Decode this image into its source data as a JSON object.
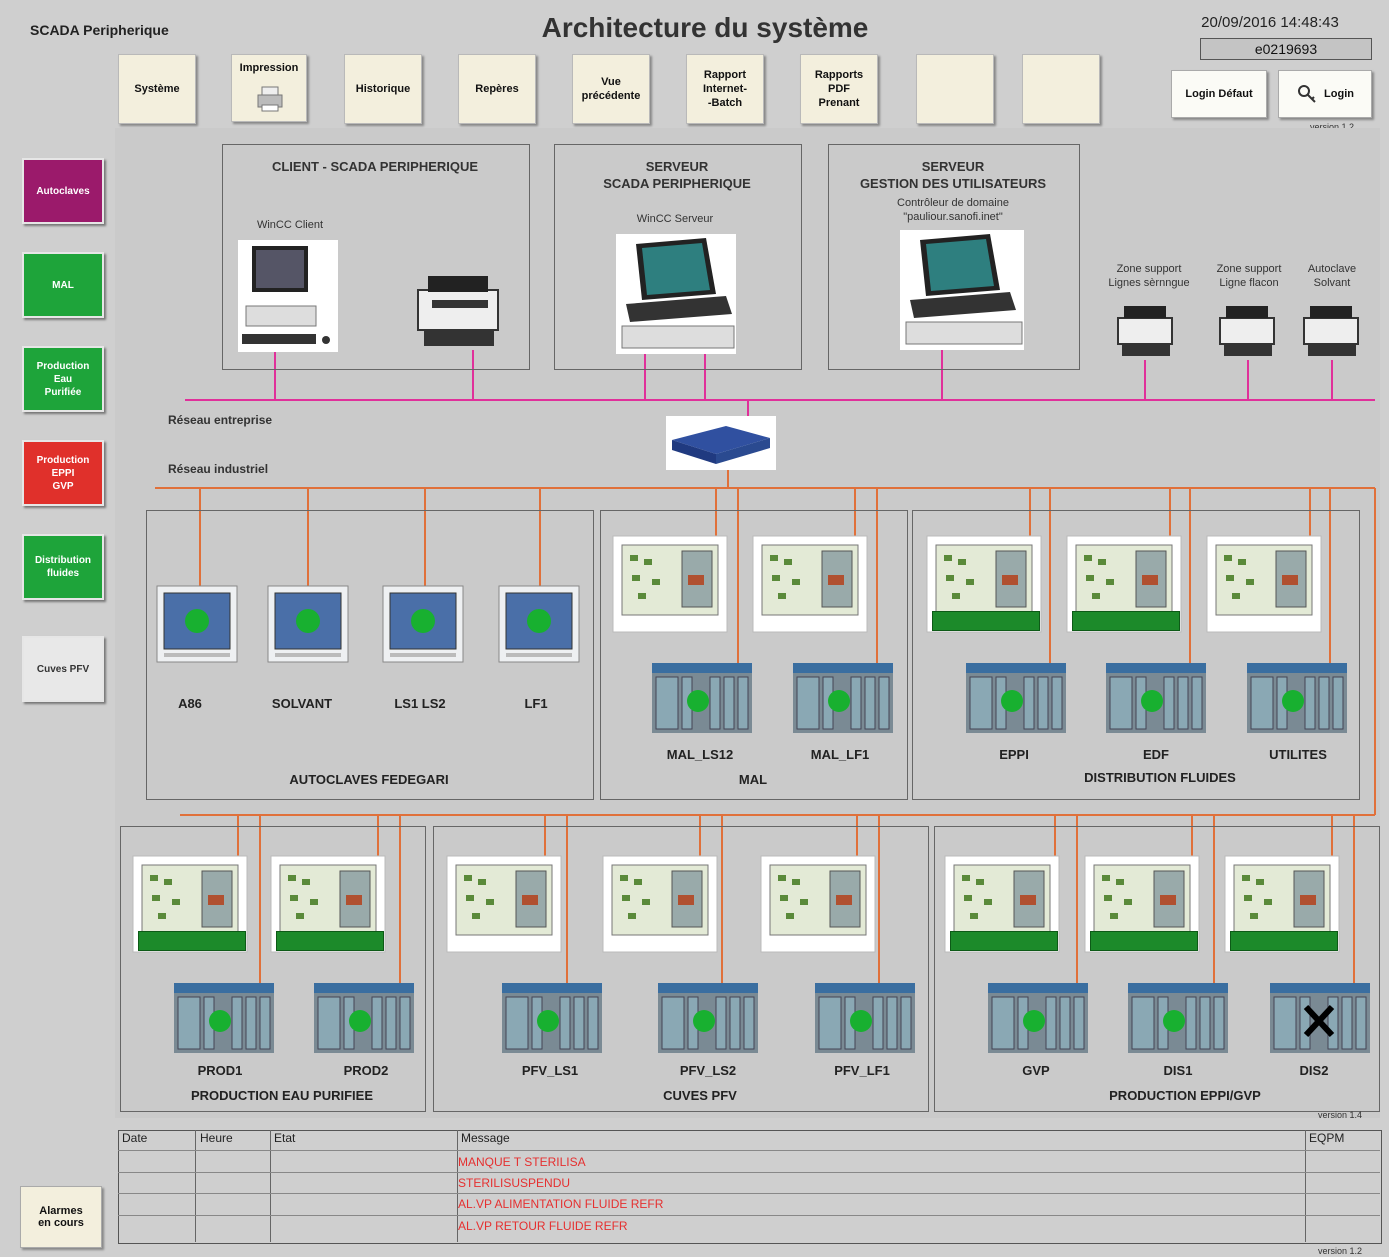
{
  "header": {
    "app_name": "SCADA Peripherique",
    "title": "Architecture du système",
    "datetime": "20/09/2016 14:48:43",
    "user": "e0219693",
    "version_top": "version 1.2"
  },
  "toolbar": {
    "buttons": [
      "Système",
      "Impression",
      "Historique",
      "Repères",
      "Vue\nprécédente",
      "Rapport\nInternet-\n-Batch",
      "Rapports\nPDF\nPrenant",
      "",
      ""
    ],
    "login_default": "Login Défaut",
    "login": "Login"
  },
  "sidebar": {
    "items": [
      {
        "label": "Autoclaves",
        "color": "#9b1a6b"
      },
      {
        "label": "MAL",
        "color": "#1ea43a"
      },
      {
        "label": "Production\nEau\nPurifiée",
        "color": "#1ea43a"
      },
      {
        "label": "Production\nEPPI\nGVP",
        "color": "#e0302b"
      },
      {
        "label": "Distribution\nfluides",
        "color": "#1ea43a"
      },
      {
        "label": "Cuves PFV",
        "color": "#e8e8e8"
      }
    ],
    "alarm_button": "Alarmes\nen cours"
  },
  "network": {
    "client_box": "CLIENT - SCADA PERIPHERIQUE",
    "client_wincc": "WinCC Client",
    "server_box": "SERVEUR\nSCADA PERIPHERIQUE",
    "server_wincc": "WinCC Serveur",
    "users_box": "SERVEUR\nGESTION DES UTILISATEURS",
    "users_sub": "Contrôleur de domaine\n\"pauliour.sanofi.inet\"",
    "printer1": "Zone support\nLignes sèrnngue",
    "printer2": "Zone support\nLigne flacon",
    "printer3": "Autoclave\nSolvant",
    "enterprise_net": "Réseau entreprise",
    "industrial_net": "Réseau industriel"
  },
  "groups": {
    "autoclaves": {
      "title": "AUTOCLAVES FEDEGARI",
      "items": [
        "A86",
        "SOLVANT",
        "LS1 LS2",
        "LF1"
      ]
    },
    "mal": {
      "title": "MAL",
      "items": [
        "MAL_LS12",
        "MAL_LF1"
      ]
    },
    "distribution": {
      "title": "DISTRIBUTION FLUIDES",
      "items": [
        "EPPI",
        "EDF",
        "UTILITES"
      ]
    },
    "production_eau": {
      "title": "PRODUCTION EAU PURIFIEE",
      "items": [
        "PROD1",
        "PROD2"
      ]
    },
    "cuves": {
      "title": "CUVES PFV",
      "items": [
        "PFV_LS1",
        "PFV_LS2",
        "PFV_LF1"
      ]
    },
    "production_eppi": {
      "title": "PRODUCTION EPPI/GVP",
      "items": [
        "GVP",
        "DIS1",
        "DIS2"
      ]
    }
  },
  "version_mid": "version 1.4",
  "alarms": {
    "columns": [
      "Date",
      "Heure",
      "Etat",
      "Message",
      "EQPM"
    ],
    "rows": [
      {
        "message": "MANQUE T STERILISA"
      },
      {
        "message": "STERILISUSPENDU"
      },
      {
        "message": "AL.VP ALIMENTATION FLUIDE REFR"
      },
      {
        "message": "AL.VP RETOUR FLUIDE REFR"
      }
    ]
  },
  "version_bottom": "version 1.2",
  "colors": {
    "enterprise_line": "#e0309a",
    "industrial_line": "#e0703a",
    "status_green": "#18b030",
    "alarm_text": "#e53030"
  }
}
